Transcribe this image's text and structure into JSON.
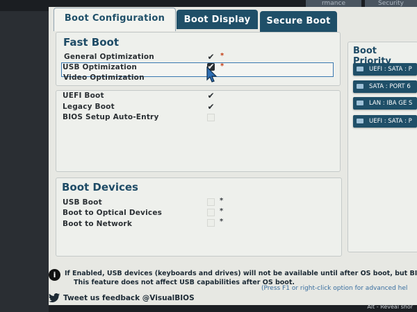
{
  "top_tabs": [
    {
      "label": "rmance"
    },
    {
      "label": "Security"
    }
  ],
  "tabs": [
    {
      "label": "Boot Configuration",
      "active": true
    },
    {
      "label": "Boot Display",
      "active": false
    },
    {
      "label": "Secure Boot",
      "active": false
    }
  ],
  "fast_boot": {
    "title": "Fast Boot",
    "items": [
      {
        "label": "General Optimization",
        "checked": true,
        "asterisk": "*"
      },
      {
        "label": "USB Optimization",
        "checked": true,
        "asterisk": "*",
        "selected": true
      },
      {
        "label": "Video Optimization",
        "checked": false,
        "asterisk": ""
      }
    ]
  },
  "boot_modes": {
    "items": [
      {
        "label": "UEFI Boot",
        "checked": true
      },
      {
        "label": "Legacy Boot",
        "checked": true
      },
      {
        "label": "BIOS Setup Auto-Entry",
        "checked": false
      }
    ]
  },
  "boot_devices": {
    "title": "Boot Devices",
    "items": [
      {
        "label": "USB Boot",
        "checked": false,
        "asterisk": "*"
      },
      {
        "label": "Boot to Optical Devices",
        "checked": false,
        "asterisk": "*"
      },
      {
        "label": "Boot to Network",
        "checked": false,
        "asterisk": "*"
      }
    ]
  },
  "boot_priority": {
    "title": "Boot Priority",
    "items": [
      {
        "label": "UEFI : SATA : P"
      },
      {
        "label": "SATA : PORT 6"
      },
      {
        "label": "LAN : IBA GE S"
      },
      {
        "label": "UEFI : SATA : P"
      }
    ]
  },
  "info": {
    "line1": "If Enabled, USB devices (keyboards and drives) will not be available until after OS boot, but BIOS",
    "line2": "This feature does not affect USB capabilities after OS boot.",
    "help": "(Press F1 or right-click option for advanced hel"
  },
  "feedback": "Tweet us feedback @VisualBIOS",
  "bottom_hint": "Alt - Reveal shor",
  "colors": {
    "tab_bg": "#1f4f68",
    "section_title": "#1e4b66",
    "asterisk_red": "#c33b12"
  },
  "icons": {
    "info": "info-icon",
    "twitter": "twitter-icon",
    "check": "checkmark-icon",
    "drive": "drive-icon",
    "cursor": "mouse-cursor-icon"
  }
}
